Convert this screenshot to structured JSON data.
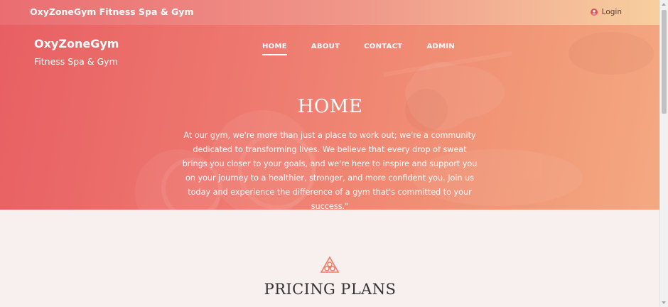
{
  "topbar": {
    "brand": "OxyZoneGym Fitness Spa & Gym",
    "login_label": "Login",
    "login_icon": "user-circle-icon"
  },
  "header": {
    "site_title": "OxyZoneGym",
    "site_subtitle": "Fitness Spa & Gym"
  },
  "nav": {
    "items": [
      {
        "label": "HOME",
        "active": true
      },
      {
        "label": "ABOUT",
        "active": false
      },
      {
        "label": "CONTACT",
        "active": false
      },
      {
        "label": "ADMIN",
        "active": false
      }
    ]
  },
  "hero": {
    "heading": "HOME",
    "text": "At our gym, we're more than just a place to work out; we're a community dedicated to transforming lives. We believe that every drop of sweat brings you closer to your goals, and we're here to inspire and support you on your journey to a healthier, stronger, and more confident you. Join us today and experience the difference of a gym that's committed to your success.\""
  },
  "pricing": {
    "icon": "triangle-lotus-icon",
    "title": "PRICING PLANS"
  },
  "colors": {
    "hero_start": "#e85f63",
    "hero_end": "#f4a981",
    "topbar_end": "#f7cf9f",
    "accent": "#ef7a64",
    "background": "#f8f0ee"
  }
}
